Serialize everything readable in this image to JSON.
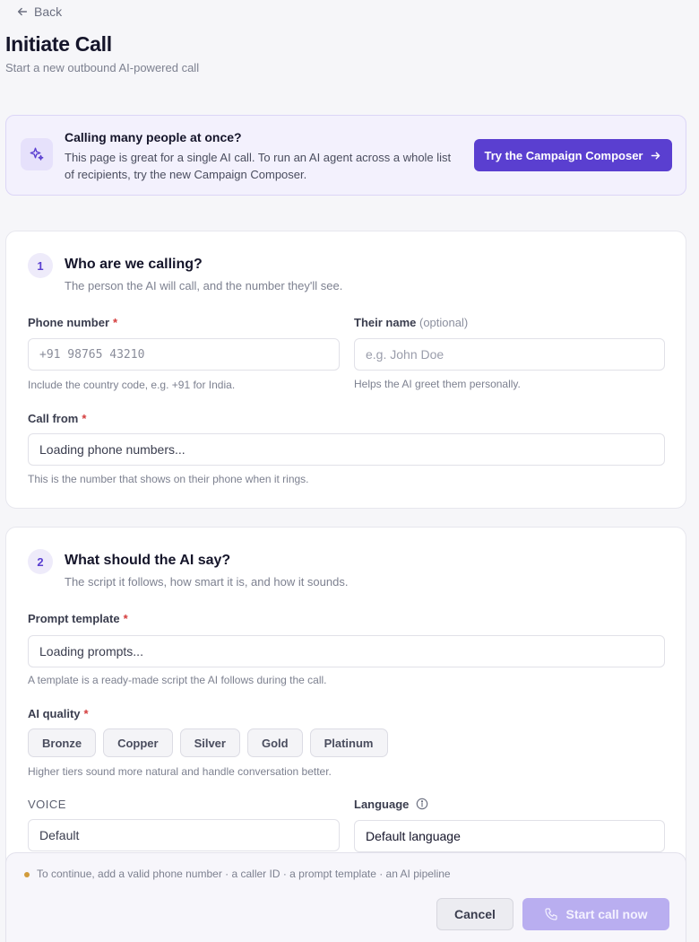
{
  "nav": {
    "back_label": "Back"
  },
  "header": {
    "title": "Initiate Call",
    "subtitle": "Start a new outbound AI-powered call"
  },
  "banner": {
    "icon": "sparkle-icon",
    "title": "Calling many people at once?",
    "text": "This page is great for a single AI call. To run an AI agent across a whole list of recipients, try the new Campaign Composer.",
    "button_label": "Try the Campaign Composer"
  },
  "section1": {
    "step": "1",
    "title": "Who are we calling?",
    "subtitle": "The person the AI will call, and the number they'll see.",
    "phone": {
      "label": "Phone number",
      "required_mark": "*",
      "placeholder": "+91 98765 43210",
      "help": "Include the country code, e.g. +91 for India."
    },
    "name": {
      "label": "Their name",
      "optional_text": "(optional)",
      "placeholder": "e.g. John Doe",
      "help": "Helps the AI greet them personally."
    },
    "call_from": {
      "label": "Call from",
      "required_mark": "*",
      "value": "Loading phone numbers...",
      "help": "This is the number that shows on their phone when it rings."
    }
  },
  "section2": {
    "step": "2",
    "title": "What should the AI say?",
    "subtitle": "The script it follows, how smart it is, and how it sounds.",
    "prompt": {
      "label": "Prompt template",
      "required_mark": "*",
      "value": "Loading prompts...",
      "help": "A template is a ready-made script the AI follows during the call."
    },
    "quality": {
      "label": "AI quality",
      "required_mark": "*",
      "tiers": [
        "Bronze",
        "Copper",
        "Silver",
        "Gold",
        "Platinum"
      ],
      "help": "Higher tiers sound more natural and handle conversation better."
    },
    "voice": {
      "label": "VOICE",
      "value": "Default"
    },
    "language": {
      "label": "Language",
      "value": "Default language"
    }
  },
  "footer": {
    "message": "To continue, add a valid phone number · a caller ID · a prompt template · an AI pipeline",
    "cancel_label": "Cancel",
    "start_label": "Start call now"
  },
  "colors": {
    "accent": "#5a3fd0",
    "accent_disabled": "#b9aef0",
    "required": "#d43c3c",
    "warning_dot": "#d19b3c"
  }
}
